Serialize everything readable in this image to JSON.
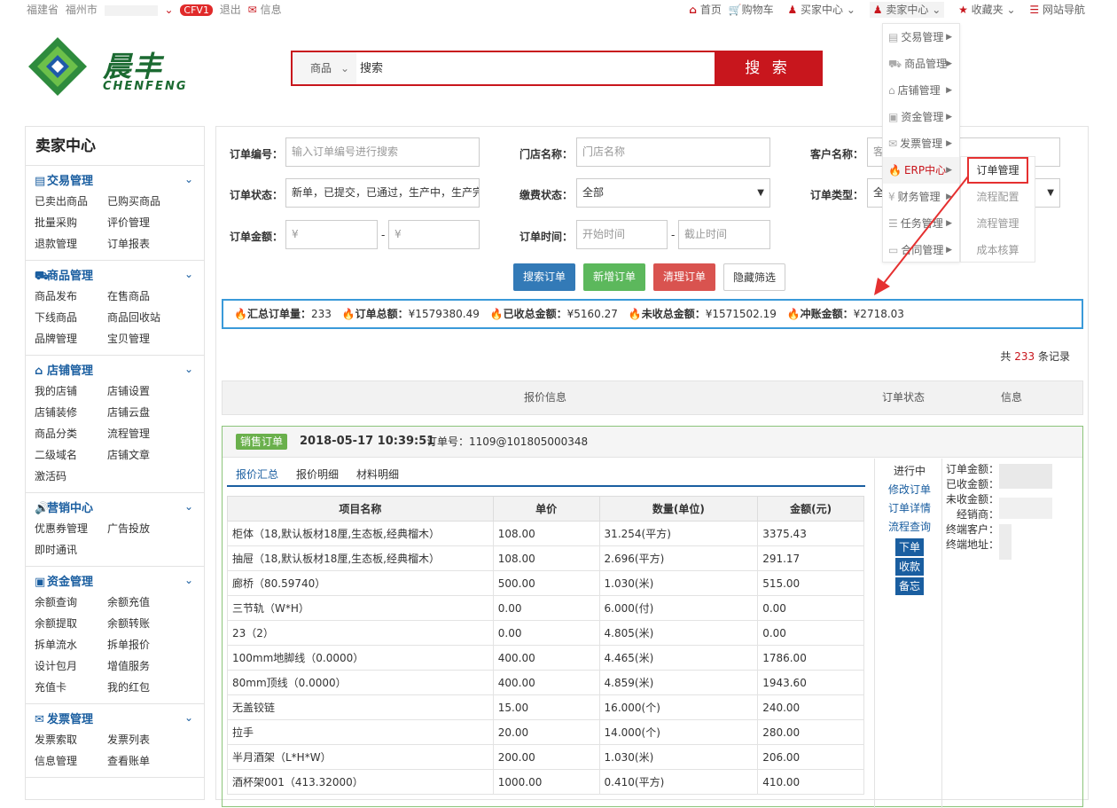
{
  "topbar": {
    "province": "福建省",
    "city": "福州市",
    "badge": "CFV1",
    "logout": "退出",
    "message": "信息",
    "home": "首页",
    "cart": "购物车",
    "buyer_center": "买家中心",
    "seller_center": "卖家中心",
    "favorites": "收藏夹",
    "site_nav": "网站导航"
  },
  "logo": {
    "cn": "晨丰",
    "en": "CHENFENG"
  },
  "search": {
    "category": "商品",
    "placeholder": "搜索",
    "button": "搜 索"
  },
  "sidebar": {
    "title": "卖家中心",
    "sections": [
      {
        "title": "交易管理",
        "icon": "list-icon",
        "items": [
          "已卖出商品",
          "已购买商品",
          "批量采购",
          "评价管理",
          "退款管理",
          "订单报表"
        ]
      },
      {
        "title": "商品管理",
        "icon": "truck-icon",
        "items": [
          "商品发布",
          "在售商品",
          "下线商品",
          "商品回收站",
          "品牌管理",
          "宝贝管理"
        ]
      },
      {
        "title": "店铺管理",
        "icon": "home-icon",
        "items": [
          "我的店铺",
          "店铺设置",
          "店铺装修",
          "店铺云盘",
          "商品分类",
          "流程管理",
          "二级域名",
          "店铺文章",
          "激活码"
        ]
      },
      {
        "title": "营销中心",
        "icon": "speaker-icon",
        "items": [
          "优惠券管理",
          "广告投放",
          "即时通讯"
        ]
      },
      {
        "title": "资金管理",
        "icon": "money-icon",
        "items": [
          "余额查询",
          "余额充值",
          "余额提取",
          "余额转账",
          "拆单流水",
          "拆单报价",
          "设计包月",
          "增值服务",
          "充值卡",
          "我的红包"
        ]
      },
      {
        "title": "发票管理",
        "icon": "envelope-icon",
        "items": [
          "发票索取",
          "发票列表",
          "信息管理",
          "查看账单"
        ]
      }
    ]
  },
  "filters": {
    "order_no_label": "订单编号：",
    "order_no_placeholder": "输入订单编号进行搜索",
    "store_label": "门店名称：",
    "store_placeholder": "门店名称",
    "customer_label": "客户名称：",
    "customer_placeholder": "客",
    "status_label": "订单状态：",
    "status_value": "新单，已提交，已通过，生产中，生产完成",
    "payment_label": "缴费状态：",
    "payment_value": "全部",
    "type_label": "订单类型：",
    "type_value": "全",
    "amount_label": "订单金额：",
    "amount_min_placeholder": "¥",
    "amount_max_placeholder": "¥",
    "time_label": "订单时间：",
    "time_start_placeholder": "开始时间",
    "time_end_placeholder": "截止时间",
    "dash": "-"
  },
  "actions": {
    "search": "搜索订单",
    "new": "新增订单",
    "clear": "清理订单",
    "hide": "隐藏筛选",
    "colors": {
      "search": "#337ab7",
      "new": "#5cb85c",
      "clear": "#d9534f"
    }
  },
  "summary": {
    "total_count_label": "汇总订单量：",
    "total_count": "233",
    "total_amount_label": "订单总额：",
    "total_amount": "¥1579380.49",
    "received_label": "已收总金额：",
    "received": "¥5160.27",
    "unreceived_label": "未收总金额：",
    "unreceived": "¥1571502.19",
    "offset_label": "冲账金额：",
    "offset": "¥2718.03"
  },
  "records": {
    "prefix": "共",
    "count": "233",
    "suffix": "条记录"
  },
  "table_header": {
    "quote": "报价信息",
    "status": "订单状态",
    "info": "信息"
  },
  "order": {
    "tag": "销售订单",
    "date": "2018-05-17 10:39:51",
    "number": "订单号：1109@101805000348",
    "tabs": [
      "报价汇总",
      "报价明细",
      "材料明细"
    ],
    "columns": [
      "项目名称",
      "单价",
      "数量(单位)",
      "金额(元)"
    ],
    "rows": [
      [
        "柜体（18,默认板材18厘,生态板,经典榴木）",
        "108.00",
        "31.254(平方)",
        "3375.43"
      ],
      [
        "抽屉（18,默认板材18厘,生态板,经典榴木）",
        "108.00",
        "2.696(平方)",
        "291.17"
      ],
      [
        "廊桥（80.59740）",
        "500.00",
        "1.030(米)",
        "515.00"
      ],
      [
        "三节轨（W*H）",
        "0.00",
        "6.000(付)",
        "0.00"
      ],
      [
        "23（2）",
        "0.00",
        "4.805(米)",
        "0.00"
      ],
      [
        "100mm地脚线（0.0000）",
        "400.00",
        "4.465(米)",
        "1786.00"
      ],
      [
        "80mm顶线（0.0000）",
        "400.00",
        "4.859(米)",
        "1943.60"
      ],
      [
        "无盖铰链",
        "15.00",
        "16.000(个)",
        "240.00"
      ],
      [
        "拉手",
        "20.00",
        "14.000(个)",
        "280.00"
      ],
      [
        "半月酒架（L*H*W）",
        "200.00",
        "1.030(米)",
        "206.00"
      ],
      [
        "酒杯架001（413.32000）",
        "1000.00",
        "0.410(平方)",
        "410.00"
      ]
    ],
    "status": "进行中",
    "links": [
      "修改订单",
      "订单详情",
      "流程查询"
    ],
    "buttons": [
      "下单",
      "收款",
      "备忘"
    ],
    "info_labels": [
      "订单金额：",
      "已收金额：",
      "未收金额：",
      "经销商：",
      "终端客户：",
      "终端地址："
    ]
  },
  "dropdown": {
    "items": [
      "交易管理",
      "商品管理",
      "店铺管理",
      "资金管理",
      "发票管理",
      "ERP中心",
      "财务管理",
      "任务管理",
      "合同管理"
    ],
    "sub_items": [
      "订单管理",
      "流程配置",
      "流程管理",
      "成本核算"
    ]
  }
}
